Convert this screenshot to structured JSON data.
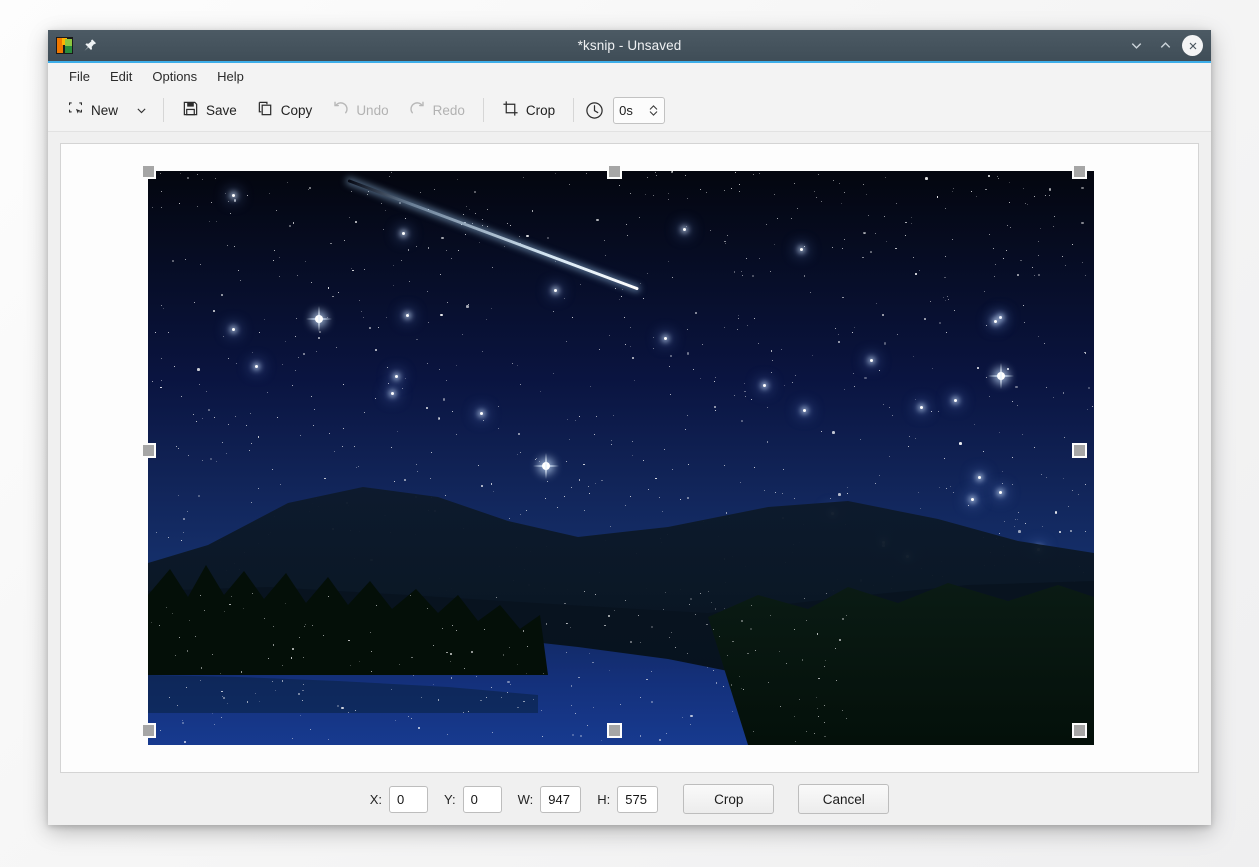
{
  "window": {
    "title": "*ksnip - Unsaved",
    "app_icon": "ksnip-logo-icon",
    "pin_icon": "pin-icon",
    "controls": {
      "minimize": "chevron-down-icon",
      "maximize": "chevron-up-icon",
      "close": "close-icon"
    }
  },
  "menubar": {
    "items": [
      {
        "label": "File"
      },
      {
        "label": "Edit"
      },
      {
        "label": "Options"
      },
      {
        "label": "Help"
      }
    ]
  },
  "toolbar": {
    "new_label": "New",
    "new_icon": "new-capture-icon",
    "new_dropdown_icon": "chevron-down-icon",
    "save_label": "Save",
    "save_icon": "floppy-disk-icon",
    "copy_label": "Copy",
    "copy_icon": "copy-icon",
    "undo_label": "Undo",
    "undo_icon": "undo-arrow-icon",
    "undo_disabled": true,
    "redo_label": "Redo",
    "redo_icon": "redo-arrow-icon",
    "redo_disabled": true,
    "crop_label": "Crop",
    "crop_icon": "crop-icon",
    "delay_icon": "clock-icon",
    "delay_value": "0s",
    "delay_stepper_up": "▲",
    "delay_stepper_down": "▼"
  },
  "canvas": {
    "image_alt": "night-sky-lake-screenshot",
    "crop_selection_active": true,
    "handle_count": 8
  },
  "cropbar": {
    "x_label": "X:",
    "x_value": "0",
    "y_label": "Y:",
    "y_value": "0",
    "w_label": "W:",
    "w_value": "947",
    "h_label": "H:",
    "h_value": "575",
    "crop_button": "Crop",
    "cancel_button": "Cancel"
  },
  "colors": {
    "titlebar": "#3f4d57",
    "accent": "#3daee9",
    "toolbar_bg": "#f3f3f3",
    "canvas_bg": "#fdfdfd",
    "handle": "#a6a6a6"
  }
}
